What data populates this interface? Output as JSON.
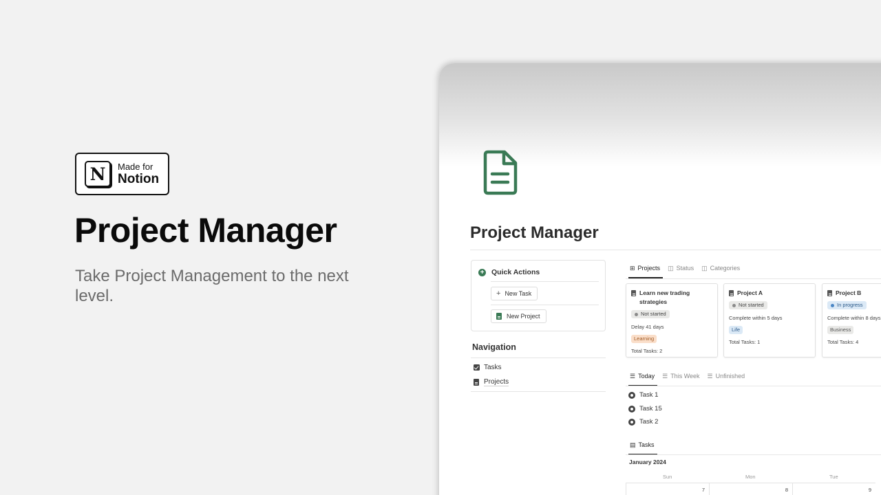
{
  "hero": {
    "badge_small": "Made for",
    "badge_big": "Notion",
    "badge_logo_letter": "N",
    "title": "Project Manager",
    "subtitle": "Take Project Management to the next level."
  },
  "page": {
    "title": "Project Manager",
    "icon": "document-icon",
    "accent_color": "#3a7a55"
  },
  "quick_actions": {
    "title": "Quick Actions",
    "buttons": [
      {
        "label": "New Task",
        "icon": "plus-icon"
      },
      {
        "label": "New Project",
        "icon": "document-icon"
      }
    ]
  },
  "navigation": {
    "title": "Navigation",
    "items": [
      {
        "label": "Tasks",
        "icon": "checkbox-icon"
      },
      {
        "label": "Projects",
        "icon": "document-icon"
      }
    ]
  },
  "project_tabs": [
    {
      "label": "Projects",
      "icon": "gallery-icon",
      "active": true
    },
    {
      "label": "Status",
      "icon": "board-icon",
      "active": false
    },
    {
      "label": "Categories",
      "icon": "board-icon",
      "active": false
    }
  ],
  "projects": [
    {
      "title": "Learn new trading strategies",
      "status": "Not started",
      "line": "Delay 41 days",
      "tag": "Learning",
      "total": "Total Tasks: 2"
    },
    {
      "title": "Project A",
      "status": "Not started",
      "line": "Complete within 5 days",
      "tag": "Life",
      "total": "Total Tasks: 1"
    },
    {
      "title": "Project B",
      "status": "In progress",
      "line": "Complete within 8 days",
      "tag": "Business",
      "total": "Total Tasks: 4"
    }
  ],
  "task_tabs": [
    {
      "label": "Today",
      "icon": "list-icon",
      "active": true
    },
    {
      "label": "This Week",
      "icon": "list-icon",
      "active": false
    },
    {
      "label": "Unfinished",
      "icon": "list-icon",
      "active": false
    }
  ],
  "tasks": [
    "Task 1",
    "Task 15",
    "Task 2"
  ],
  "calendar": {
    "tab": "Tasks",
    "month": "January 2024",
    "days": [
      "Sun",
      "Mon",
      "Tue"
    ],
    "dates": [
      "7",
      "8",
      "9"
    ]
  }
}
